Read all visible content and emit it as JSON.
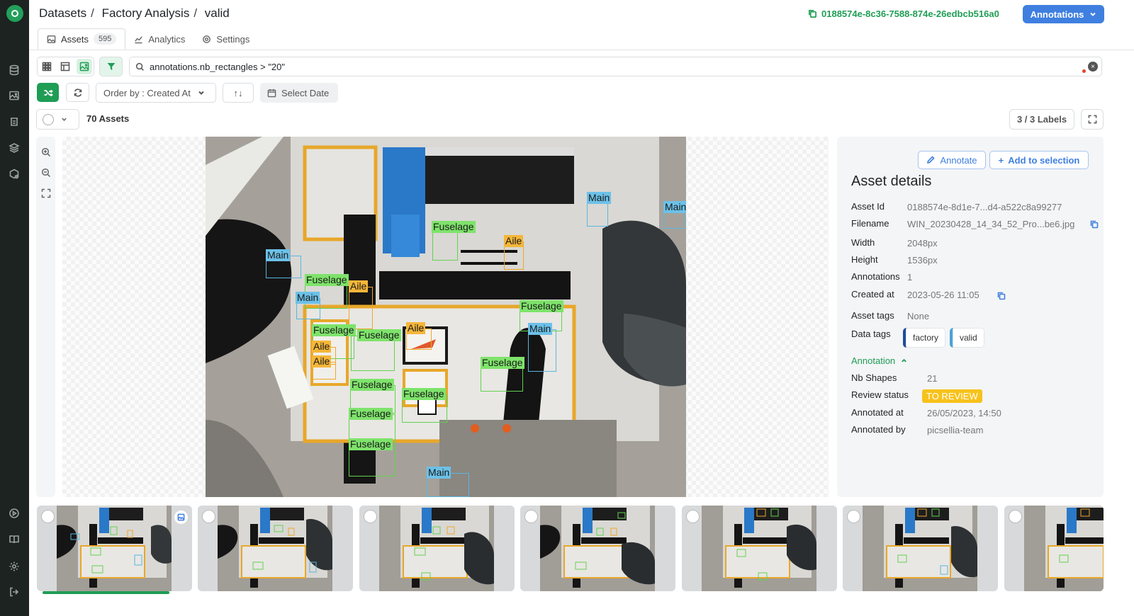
{
  "breadcrumb": [
    "Datasets",
    "Factory Analysis",
    "valid"
  ],
  "dataset_id": "0188574e-8c36-7588-874e-26edbcb516a0",
  "annotations_button": "Annotations",
  "tabs": [
    {
      "label": "Assets",
      "badge": "595"
    },
    {
      "label": "Analytics"
    },
    {
      "label": "Settings"
    }
  ],
  "search": {
    "value": "annotations.nb_rectangles > \"20\"",
    "clear": "×"
  },
  "toolbar": {
    "order_by": "Order by : Created At",
    "sort_dir": "↑↓",
    "select_date": "Select Date"
  },
  "assets_count": "70 Assets",
  "labels_count": "3 / 3 Labels",
  "annotation_labels": {
    "f": "Fuselage",
    "a": "Aile",
    "m": "Main"
  },
  "details": {
    "annotate": "Annotate",
    "add_to_selection": "Add to selection",
    "title": "Asset details",
    "fields": [
      {
        "k": "Asset Id",
        "v": "0188574e-8d1e-7...d4-a522c8a99277"
      },
      {
        "k": "Filename",
        "v": "WIN_20230428_14_34_52_Pro...be6.jpg"
      },
      {
        "k": "Width",
        "v": "2048px"
      },
      {
        "k": "Height",
        "v": "1536px"
      },
      {
        "k": "Annotations",
        "v": "1"
      },
      {
        "k": "Created at",
        "v": "2023-05-26 11:05"
      },
      {
        "k": "Asset tags",
        "v": "None"
      },
      {
        "k": "Data tags",
        "v": ""
      }
    ],
    "data_tags": [
      {
        "label": "factory",
        "color": "#1f4e9a"
      },
      {
        "label": "valid",
        "color": "#4aa3d8"
      }
    ],
    "annotation_section": "Annotation",
    "annotation_fields": [
      {
        "k": "Nb Shapes",
        "v": "21"
      },
      {
        "k": "Review status",
        "v": "TO REVIEW"
      },
      {
        "k": "Annotated at",
        "v": "26/05/2023, 14:50"
      },
      {
        "k": "Annotated by",
        "v": "picsellia-team"
      }
    ]
  },
  "colors": {
    "brand_green": "#1f9d55",
    "primary_blue": "#3f7fe0",
    "review_yellow": "#f7c21c"
  }
}
